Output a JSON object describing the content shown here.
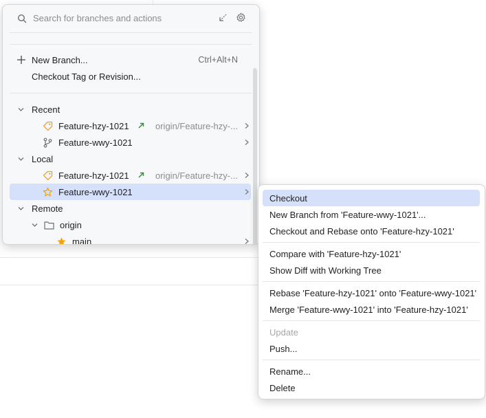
{
  "search": {
    "placeholder": "Search for branches and actions"
  },
  "actions": {
    "new_branch": {
      "label": "New Branch...",
      "shortcut": "Ctrl+Alt+N"
    },
    "checkout_tag": {
      "label": "Checkout Tag or Revision..."
    }
  },
  "tree": {
    "recent": {
      "label": "Recent",
      "items": [
        {
          "name": "Feature-hzy-1021",
          "tracking": "origin/Feature-hzy-...",
          "icon": "tag-icon",
          "arrow": "outgoing-arrow-icon"
        },
        {
          "name": "Feature-wwy-1021",
          "icon": "branch-icon"
        }
      ]
    },
    "local": {
      "label": "Local",
      "items": [
        {
          "name": "Feature-hzy-1021",
          "tracking": "origin/Feature-hzy-...",
          "icon": "tag-icon",
          "arrow": "outgoing-arrow-icon"
        },
        {
          "name": "Feature-wwy-1021",
          "icon": "star-outline-icon",
          "selected": true
        }
      ]
    },
    "remote": {
      "label": "Remote",
      "folder": "origin",
      "items": [
        {
          "name": "main",
          "icon": "star-filled-icon"
        }
      ]
    }
  },
  "context_menu": {
    "items": [
      {
        "label": "Checkout",
        "active": true
      },
      {
        "label": "New Branch from 'Feature-wwy-1021'..."
      },
      {
        "label": "Checkout and Rebase onto 'Feature-hzy-1021'"
      },
      {
        "label": "Compare with 'Feature-hzy-1021'"
      },
      {
        "label": "Show Diff with Working Tree"
      },
      {
        "label": "Rebase 'Feature-hzy-1021' onto 'Feature-wwy-1021'"
      },
      {
        "label": "Merge 'Feature-wwy-1021' into 'Feature-hzy-1021'"
      },
      {
        "label": "Update",
        "disabled": true
      },
      {
        "label": "Push..."
      },
      {
        "label": "Rename..."
      },
      {
        "label": "Delete"
      }
    ]
  },
  "colors": {
    "selection": "#d5e1fb",
    "tag_icon": "#e8a33a",
    "star_icon": "#f0a30a",
    "outgoing_arrow": "#3d8c40",
    "muted_text": "#8c8c8c"
  }
}
